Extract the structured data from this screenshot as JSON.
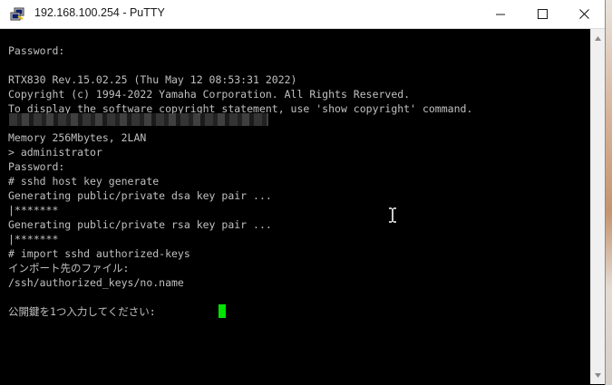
{
  "window": {
    "title": "192.168.100.254 - PuTTY",
    "controls": {
      "minimize": "minimize-icon",
      "maximize": "maximize-icon",
      "close": "close-icon"
    },
    "app_icon": "putty-icon"
  },
  "terminal": {
    "lines": [
      "Password:",
      "",
      "RTX830 Rev.15.02.25 (Thu May 12 08:53:31 2022)",
      "Copyright (c) 1994-2022 Yamaha Corporation. All Rights Reserved.",
      "To display the software copyright statement, use 'show copyright' command.",
      "",
      "Memory 256Mbytes, 2LAN",
      "> administrator",
      "Password:",
      "# sshd host key generate",
      "Generating public/private dsa key pair ...",
      "|*******",
      "Generating public/private rsa key pair ...",
      "|*******",
      "# import sshd authorized-keys",
      "インポート先のファイル:",
      "/ssh/authorized_keys/no.name",
      "",
      "公開鍵を1つ入力してください:"
    ],
    "redacted_line": "redacted-text",
    "cursor_color": "#00e400",
    "text_color": "#c0c0c0",
    "background_color": "#000000"
  },
  "scrollbar": {
    "up": "scroll-up-arrow-icon",
    "down": "scroll-down-arrow-icon"
  }
}
